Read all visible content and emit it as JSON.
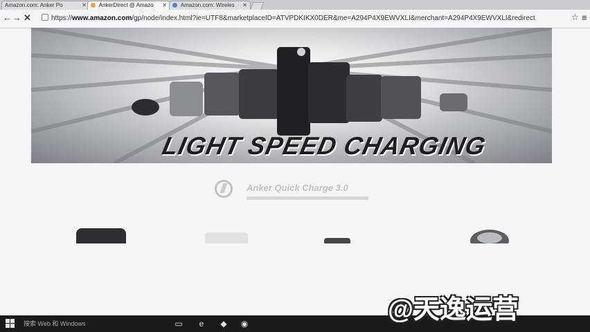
{
  "tabs": [
    {
      "label": "Amazon.com: Anker Po",
      "active": false
    },
    {
      "label": "AnkerDirect @ Amazo",
      "active": true
    },
    {
      "label": "Amazon.com: Wireles",
      "active": false
    }
  ],
  "toolbar": {
    "back_icon": "arrow-left-icon",
    "forward_icon": "arrow-right-icon",
    "reload_icon": "close-icon",
    "url_prefix": "https://",
    "url_host": "www.amazon.com",
    "url_path": "/gp/node/index.html?ie=UTF8&marketplaceID=ATVPDKIKX0DER&me=A294P4X9EWVXLI&merchant=A294P4X9EWVXLI&redirect",
    "star_icon": "star-icon",
    "menu_icon": "hamburger-menu-icon"
  },
  "hero": {
    "title": "LIGHT SPEED CHARGING"
  },
  "badge": {
    "title": "Anker Quick Charge 3.0"
  },
  "taskbar": {
    "search_text": "搜索 Web 和 Windows"
  },
  "watermark": {
    "text": "@天逸运营"
  }
}
